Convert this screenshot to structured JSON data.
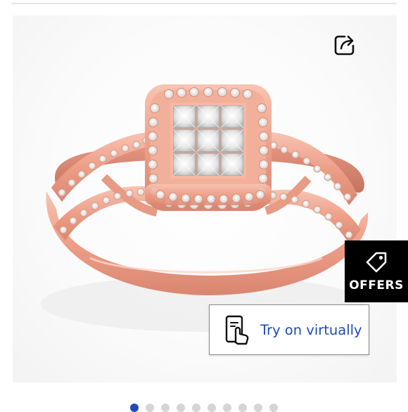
{
  "offers": {
    "label": "OFFERS"
  },
  "try_on": {
    "label": "Try on virtually"
  },
  "share": {
    "icon": "share-icon"
  },
  "carousel": {
    "total": 10,
    "active_index": 0
  },
  "colors": {
    "link_blue": "#1f4bb8",
    "offers_bg": "#000000",
    "rose_gold": "#f0a58e"
  }
}
